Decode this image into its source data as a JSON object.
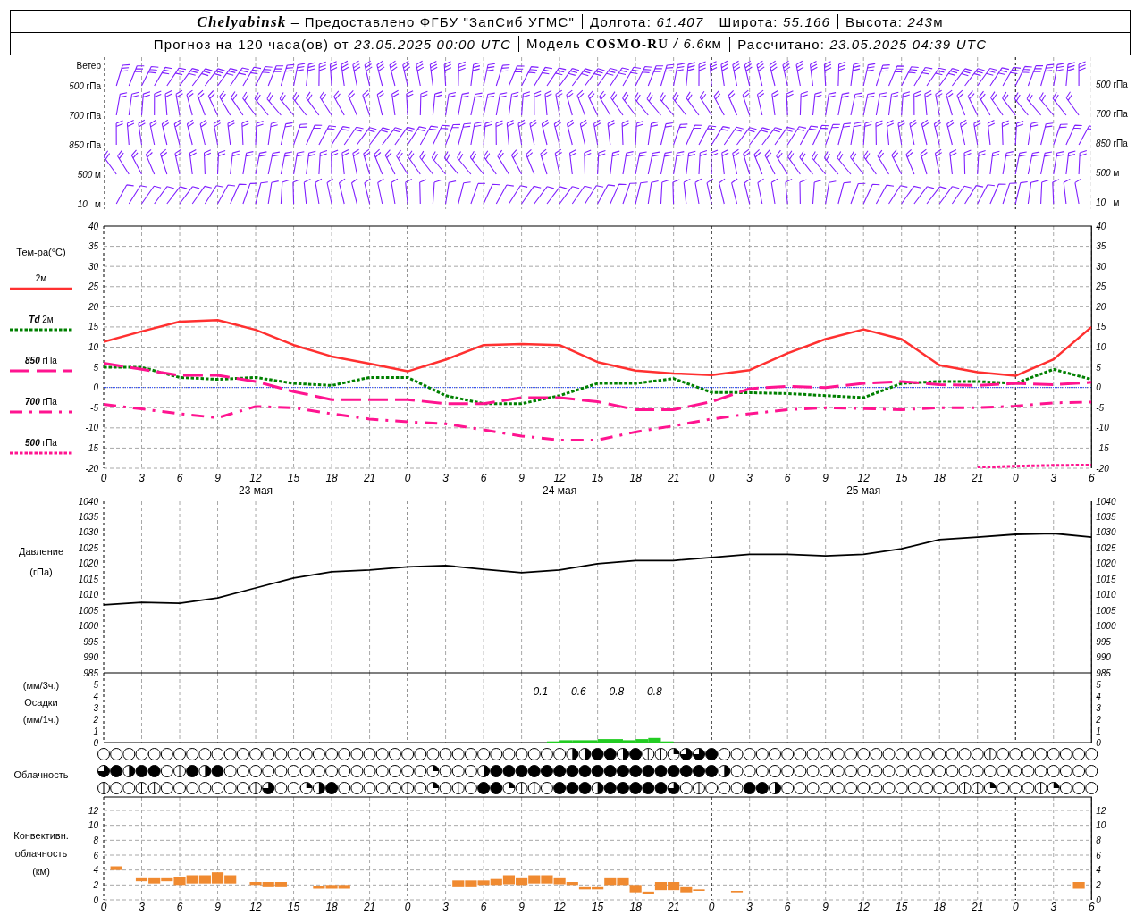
{
  "header": {
    "lines": [
      [
        [
          "**Chelyabinsk** – Предоставлено ФГБУ \"ЗапСиб УГМС\""
        ],
        [
          "Долгота: *61.407*"
        ],
        [
          "Широта: *55.166*"
        ],
        [
          "Высота: *243*",
          "м"
        ]
      ],
      [
        [
          "Прогноз на 120 часа(ов) от *23.05.2025 00:00 UTC*"
        ],
        [
          "Модель **COSMO-RU** */ 6.6*",
          "км"
        ],
        [
          "Рассчитано: *23.05.2025 04:39 UTC*"
        ]
      ]
    ]
  },
  "wind": {
    "title": "Ветер",
    "left_labels": [
      "*500* гПа",
      "*700* гПа",
      "*850* гПа",
      "*500* м",
      "*10*   м"
    ],
    "right_labels": [
      "*500* гПа",
      "*700* гПа",
      "*850* гПа",
      "*500* м",
      "*10*   м"
    ]
  },
  "temperature": {
    "title": "Тем-ра(°C)",
    "date_labels": [
      "23 мая",
      "24 мая",
      "25 мая"
    ],
    "chart_data": {
      "type": "line",
      "grid": true,
      "xlim": [
        "2025-05-23T00:00",
        "2025-05-26T06:00"
      ],
      "x": [
        "2025-05-23T00:00",
        "2025-05-23T03:00",
        "2025-05-23T06:00",
        "2025-05-23T09:00",
        "2025-05-23T12:00",
        "2025-05-23T15:00",
        "2025-05-23T18:00",
        "2025-05-23T21:00",
        "2025-05-24T00:00",
        "2025-05-24T03:00",
        "2025-05-24T06:00",
        "2025-05-24T09:00",
        "2025-05-24T12:00",
        "2025-05-24T15:00",
        "2025-05-24T18:00",
        "2025-05-24T21:00",
        "2025-05-25T00:00",
        "2025-05-25T03:00",
        "2025-05-25T06:00",
        "2025-05-25T09:00",
        "2025-05-25T12:00",
        "2025-05-25T15:00",
        "2025-05-25T18:00",
        "2025-05-25T21:00",
        "2025-05-26T00:00",
        "2025-05-26T03:00",
        "2025-05-26T06:00"
      ],
      "ylim": [
        -20,
        40
      ],
      "y2lim": [
        -20,
        40
      ],
      "yticks": [
        -20,
        -15,
        -10,
        -5,
        0,
        5,
        10,
        15,
        20,
        25,
        30,
        35,
        40
      ],
      "y2ticks": [
        -20,
        -15,
        -10,
        -5,
        0,
        5,
        10,
        15,
        20,
        25,
        30,
        35,
        40
      ],
      "xticks": [
        {
          "value": "2025-05-23T00:00",
          "label": "0"
        },
        {
          "value": "2025-05-23T03:00",
          "label": "3"
        },
        {
          "value": "2025-05-23T06:00",
          "label": "6"
        },
        {
          "value": "2025-05-23T09:00",
          "label": "9"
        },
        {
          "value": "2025-05-23T12:00",
          "label": "12"
        },
        {
          "value": "2025-05-23T15:00",
          "label": "15"
        },
        {
          "value": "2025-05-23T18:00",
          "label": "18"
        },
        {
          "value": "2025-05-23T21:00",
          "label": "21"
        },
        {
          "value": "2025-05-24T00:00",
          "label": "0"
        },
        {
          "value": "2025-05-24T03:00",
          "label": "3"
        },
        {
          "value": "2025-05-24T06:00",
          "label": "6"
        },
        {
          "value": "2025-05-24T09:00",
          "label": "9"
        },
        {
          "value": "2025-05-24T12:00",
          "label": "12"
        },
        {
          "value": "2025-05-24T15:00",
          "label": "15"
        },
        {
          "value": "2025-05-24T18:00",
          "label": "18"
        },
        {
          "value": "2025-05-24T21:00",
          "label": "21"
        },
        {
          "value": "2025-05-25T00:00",
          "label": "0"
        },
        {
          "value": "2025-05-25T03:00",
          "label": "3"
        },
        {
          "value": "2025-05-25T06:00",
          "label": "6"
        },
        {
          "value": "2025-05-25T09:00",
          "label": "9"
        },
        {
          "value": "2025-05-25T12:00",
          "label": "12"
        },
        {
          "value": "2025-05-25T15:00",
          "label": "15"
        },
        {
          "value": "2025-05-25T18:00",
          "label": "18"
        },
        {
          "value": "2025-05-25T21:00",
          "label": "21"
        },
        {
          "value": "2025-05-26T00:00",
          "label": "0"
        },
        {
          "value": "2025-05-26T03:00",
          "label": "3"
        },
        {
          "value": "2025-05-26T06:00",
          "label": "6"
        }
      ],
      "ref_lines": [
        {
          "axis": "y",
          "value": 0,
          "color": "#2040ff"
        }
      ],
      "series": [
        {
          "name": "2м",
          "line_style": "solid",
          "color": "#ff3030",
          "values": [
            11.3,
            13.9,
            16.3,
            16.7,
            14.3,
            10.5,
            7.7,
            5.9,
            4,
            6.9,
            10.5,
            10.8,
            10.5,
            6.3,
            4.2,
            3.5,
            3.1,
            4.3,
            8.5,
            12,
            14.4,
            12,
            5.5,
            3.8,
            2.9,
            7,
            15
          ]
        },
        {
          "name": "*Td* 2м",
          "line_style": "dotted",
          "color": "#008000",
          "values": [
            5,
            5,
            2.5,
            2,
            2.5,
            1,
            0.5,
            2.5,
            2.5,
            -2,
            -4,
            -4,
            -2,
            1,
            1,
            2.2,
            -1.2,
            -1.3,
            -1.5,
            -2,
            -2.5,
            1,
            1.5,
            1.5,
            1,
            4.5,
            2
          ]
        },
        {
          "name": "*850* гПа",
          "line_style": "dashed",
          "color": "#ff1490",
          "values": [
            6,
            4.5,
            3,
            3,
            1.5,
            -1,
            -3,
            -3,
            -3,
            -4,
            -4,
            -2.5,
            -2.5,
            -3.5,
            -5.5,
            -5.5,
            -3.5,
            -0.3,
            0.3,
            0,
            1,
            1.5,
            0.7,
            0.5,
            1,
            0.7,
            1.3
          ]
        },
        {
          "name": "*700* гПа",
          "line_style": "dashdot",
          "color": "#ff1490",
          "values": [
            -4.2,
            -5.3,
            -6.5,
            -7.5,
            -4.7,
            -5,
            -6.5,
            -7.8,
            -8.5,
            -9,
            -10.5,
            -12,
            -13,
            -13,
            -11,
            -9.5,
            -7.8,
            -6.5,
            -5.5,
            -5,
            -5.2,
            -5.5,
            -5,
            -5,
            -4.6,
            -3.8,
            -3.6
          ]
        },
        {
          "name": "*500* гПа",
          "line_style": "dotted",
          "color": "#ff1490",
          "values": [
            null,
            null,
            null,
            null,
            null,
            null,
            null,
            null,
            null,
            null,
            null,
            null,
            null,
            null,
            null,
            null,
            null,
            null,
            null,
            null,
            null,
            null,
            null,
            -19.8,
            -19.5,
            -19.3,
            -19.2
          ]
        }
      ]
    }
  },
  "pressure": {
    "labels": [
      "Давление",
      "(гПа)"
    ],
    "chart_data": {
      "type": "line",
      "grid": true,
      "xlim": [
        "2025-05-23T00:00",
        "2025-05-26T06:00"
      ],
      "x": [
        "2025-05-23T00:00",
        "2025-05-23T03:00",
        "2025-05-23T06:00",
        "2025-05-23T09:00",
        "2025-05-23T12:00",
        "2025-05-23T15:00",
        "2025-05-23T18:00",
        "2025-05-23T21:00",
        "2025-05-24T00:00",
        "2025-05-24T03:00",
        "2025-05-24T06:00",
        "2025-05-24T09:00",
        "2025-05-24T12:00",
        "2025-05-24T15:00",
        "2025-05-24T18:00",
        "2025-05-24T21:00",
        "2025-05-25T00:00",
        "2025-05-25T03:00",
        "2025-05-25T06:00",
        "2025-05-25T09:00",
        "2025-05-25T12:00",
        "2025-05-25T15:00",
        "2025-05-25T18:00",
        "2025-05-25T21:00",
        "2025-05-26T00:00",
        "2025-05-26T03:00",
        "2025-05-26T06:00"
      ],
      "ylim": [
        985,
        1040
      ],
      "y2lim": [
        985,
        1040
      ],
      "yticks": [
        985,
        990,
        995,
        1000,
        1005,
        1010,
        1015,
        1020,
        1025,
        1030,
        1035,
        1040
      ],
      "y2ticks": [
        985,
        990,
        995,
        1000,
        1005,
        1010,
        1015,
        1020,
        1025,
        1030,
        1035,
        1040
      ],
      "series": [
        {
          "color": "#000000",
          "values": [
            1006.8,
            1007.6,
            1007.3,
            1009,
            1012.2,
            1015.4,
            1017.4,
            1018,
            1019,
            1019.4,
            1018.2,
            1017.1,
            1018,
            1020,
            1021,
            1021,
            1022,
            1023,
            1023,
            1022.5,
            1023,
            1024.8,
            1027.7,
            1028.5,
            1029.4,
            1029.7,
            1028.5
          ]
        }
      ]
    }
  },
  "precipitation": {
    "labels": [
      "(мм/3ч.)",
      "Осадки",
      "(мм/1ч.)"
    ],
    "chart_data": {
      "type": "bar",
      "grid": true,
      "xlim": [
        "2025-05-23T00:00",
        "2025-05-26T06:00"
      ],
      "x": [
        "2025-05-24T11:30",
        "2025-05-24T12:30",
        "2025-05-24T13:30",
        "2025-05-24T14:30",
        "2025-05-24T15:30",
        "2025-05-24T16:30",
        "2025-05-24T17:30",
        "2025-05-24T18:30",
        "2025-05-24T19:30",
        "2025-05-24T20:30"
      ],
      "ylim": [
        0,
        6
      ],
      "y2lim": [
        0,
        6
      ],
      "yticks": [
        0,
        1,
        2,
        3,
        4,
        5
      ],
      "y2ticks": [
        0,
        1,
        2,
        3,
        4,
        5
      ],
      "series": [
        {
          "color": "#22cc22",
          "values": [
            0.1,
            0.2,
            0.2,
            0.2,
            0.3,
            0.3,
            0.2,
            0.3,
            0.4,
            0.1
          ]
        }
      ],
      "annotations": [
        "0.1",
        "0.6",
        "0.8",
        "0.8"
      ]
    }
  },
  "cloud": {
    "label": "Облачность",
    "rows": [
      {
        "cells": [
          {
            "kind": "clear"
          },
          {
            "kind": "clear"
          },
          {
            "kind": "clear"
          },
          {
            "kind": "clear"
          },
          {
            "kind": "clear"
          },
          {
            "kind": "clear"
          },
          {
            "kind": "clear"
          },
          {
            "kind": "clear"
          },
          {
            "kind": "clear"
          },
          {
            "kind": "clear"
          },
          {
            "kind": "clear"
          },
          {
            "kind": "clear"
          },
          {
            "kind": "clear"
          },
          {
            "kind": "clear"
          },
          {
            "kind": "clear"
          },
          {
            "kind": "clear"
          },
          {
            "kind": "clear"
          },
          {
            "kind": "clear"
          },
          {
            "kind": "clear"
          },
          {
            "kind": "clear"
          },
          {
            "kind": "clear"
          },
          {
            "kind": "clear"
          },
          {
            "kind": "clear"
          },
          {
            "kind": "clear"
          },
          {
            "kind": "clear"
          },
          {
            "kind": "clear"
          },
          {
            "kind": "clear"
          },
          {
            "kind": "clear"
          },
          {
            "kind": "clear"
          },
          {
            "kind": "clear"
          },
          {
            "kind": "clear"
          },
          {
            "kind": "clear"
          },
          {
            "kind": "clear"
          },
          {
            "kind": "clear"
          },
          {
            "kind": "clear"
          },
          {
            "kind": "clear"
          },
          {
            "kind": "clear"
          },
          {
            "kind": "half"
          },
          {
            "kind": "half"
          },
          {
            "kind": "overcast"
          },
          {
            "kind": "overcast"
          },
          {
            "kind": "half"
          },
          {
            "kind": "overcast"
          },
          {
            "kind": "line"
          },
          {
            "kind": "line"
          },
          {
            "kind": "quarter"
          },
          {
            "kind": "three-quarter"
          },
          {
            "kind": "three-quarter"
          },
          {
            "kind": "overcast"
          },
          {
            "kind": "clear"
          },
          {
            "kind": "clear"
          },
          {
            "kind": "clear"
          },
          {
            "kind": "clear"
          },
          {
            "kind": "clear"
          },
          {
            "kind": "clear"
          },
          {
            "kind": "clear"
          },
          {
            "kind": "clear"
          },
          {
            "kind": "clear"
          },
          {
            "kind": "clear"
          },
          {
            "kind": "clear"
          },
          {
            "kind": "clear"
          },
          {
            "kind": "clear"
          },
          {
            "kind": "clear"
          },
          {
            "kind": "clear"
          },
          {
            "kind": "clear"
          },
          {
            "kind": "clear"
          },
          {
            "kind": "clear"
          },
          {
            "kind": "clear"
          },
          {
            "kind": "clear"
          },
          {
            "kind": "clear"
          },
          {
            "kind": "line"
          },
          {
            "kind": "clear"
          },
          {
            "kind": "clear"
          },
          {
            "kind": "clear"
          },
          {
            "kind": "clear"
          },
          {
            "kind": "clear"
          },
          {
            "kind": "clear"
          },
          {
            "kind": "clear"
          },
          {
            "kind": "clear"
          }
        ]
      },
      {
        "cells": [
          {
            "kind": "three-quarter"
          },
          {
            "kind": "overcast"
          },
          {
            "kind": "half"
          },
          {
            "kind": "overcast"
          },
          {
            "kind": "overcast"
          },
          {
            "kind": "clear"
          },
          {
            "kind": "line"
          },
          {
            "kind": "overcast"
          },
          {
            "kind": "half"
          },
          {
            "kind": "overcast"
          },
          {
            "kind": "clear"
          },
          {
            "kind": "clear"
          },
          {
            "kind": "clear"
          },
          {
            "kind": "clear"
          },
          {
            "kind": "clear"
          },
          {
            "kind": "clear"
          },
          {
            "kind": "clear"
          },
          {
            "kind": "clear"
          },
          {
            "kind": "clear"
          },
          {
            "kind": "clear"
          },
          {
            "kind": "clear"
          },
          {
            "kind": "clear"
          },
          {
            "kind": "clear"
          },
          {
            "kind": "clear"
          },
          {
            "kind": "clear"
          },
          {
            "kind": "clear"
          },
          {
            "kind": "quarter"
          },
          {
            "kind": "clear"
          },
          {
            "kind": "clear"
          },
          {
            "kind": "clear"
          },
          {
            "kind": "half"
          },
          {
            "kind": "overcast"
          },
          {
            "kind": "overcast"
          },
          {
            "kind": "overcast"
          },
          {
            "kind": "overcast"
          },
          {
            "kind": "overcast"
          },
          {
            "kind": "overcast"
          },
          {
            "kind": "overcast"
          },
          {
            "kind": "overcast"
          },
          {
            "kind": "overcast"
          },
          {
            "kind": "overcast"
          },
          {
            "kind": "overcast"
          },
          {
            "kind": "overcast"
          },
          {
            "kind": "overcast"
          },
          {
            "kind": "overcast"
          },
          {
            "kind": "overcast"
          },
          {
            "kind": "overcast"
          },
          {
            "kind": "overcast"
          },
          {
            "kind": "overcast"
          },
          {
            "kind": "half"
          },
          {
            "kind": "clear"
          },
          {
            "kind": "clear"
          },
          {
            "kind": "clear"
          },
          {
            "kind": "clear"
          },
          {
            "kind": "clear"
          },
          {
            "kind": "clear"
          },
          {
            "kind": "clear"
          },
          {
            "kind": "clear"
          },
          {
            "kind": "clear"
          },
          {
            "kind": "clear"
          },
          {
            "kind": "clear"
          },
          {
            "kind": "clear"
          },
          {
            "kind": "clear"
          },
          {
            "kind": "clear"
          },
          {
            "kind": "clear"
          },
          {
            "kind": "clear"
          },
          {
            "kind": "clear"
          },
          {
            "kind": "clear"
          },
          {
            "kind": "clear"
          },
          {
            "kind": "clear"
          },
          {
            "kind": "clear"
          },
          {
            "kind": "clear"
          },
          {
            "kind": "clear"
          },
          {
            "kind": "clear"
          },
          {
            "kind": "clear"
          },
          {
            "kind": "clear"
          },
          {
            "kind": "clear"
          },
          {
            "kind": "clear"
          },
          {
            "kind": "clear"
          }
        ]
      },
      {
        "cells": [
          {
            "kind": "line"
          },
          {
            "kind": "clear"
          },
          {
            "kind": "clear"
          },
          {
            "kind": "line"
          },
          {
            "kind": "line"
          },
          {
            "kind": "clear"
          },
          {
            "kind": "clear"
          },
          {
            "kind": "clear"
          },
          {
            "kind": "clear"
          },
          {
            "kind": "clear"
          },
          {
            "kind": "clear"
          },
          {
            "kind": "clear"
          },
          {
            "kind": "line"
          },
          {
            "kind": "three-quarter"
          },
          {
            "kind": "clear"
          },
          {
            "kind": "clear"
          },
          {
            "kind": "quarter"
          },
          {
            "kind": "half"
          },
          {
            "kind": "overcast"
          },
          {
            "kind": "clear"
          },
          {
            "kind": "clear"
          },
          {
            "kind": "clear"
          },
          {
            "kind": "clear"
          },
          {
            "kind": "clear"
          },
          {
            "kind": "line"
          },
          {
            "kind": "clear"
          },
          {
            "kind": "quarter"
          },
          {
            "kind": "clear"
          },
          {
            "kind": "line"
          },
          {
            "kind": "clear"
          },
          {
            "kind": "overcast"
          },
          {
            "kind": "overcast"
          },
          {
            "kind": "quarter"
          },
          {
            "kind": "line"
          },
          {
            "kind": "line"
          },
          {
            "kind": "clear"
          },
          {
            "kind": "overcast"
          },
          {
            "kind": "overcast"
          },
          {
            "kind": "overcast"
          },
          {
            "kind": "half"
          },
          {
            "kind": "overcast"
          },
          {
            "kind": "overcast"
          },
          {
            "kind": "overcast"
          },
          {
            "kind": "overcast"
          },
          {
            "kind": "overcast"
          },
          {
            "kind": "three-quarter"
          },
          {
            "kind": "clear"
          },
          {
            "kind": "line"
          },
          {
            "kind": "clear"
          },
          {
            "kind": "clear"
          },
          {
            "kind": "clear"
          },
          {
            "kind": "overcast"
          },
          {
            "kind": "overcast"
          },
          {
            "kind": "half"
          },
          {
            "kind": "clear"
          },
          {
            "kind": "clear"
          },
          {
            "kind": "clear"
          },
          {
            "kind": "clear"
          },
          {
            "kind": "clear"
          },
          {
            "kind": "clear"
          },
          {
            "kind": "clear"
          },
          {
            "kind": "clear"
          },
          {
            "kind": "clear"
          },
          {
            "kind": "clear"
          },
          {
            "kind": "clear"
          },
          {
            "kind": "clear"
          },
          {
            "kind": "clear"
          },
          {
            "kind": "clear"
          },
          {
            "kind": "line"
          },
          {
            "kind": "line"
          },
          {
            "kind": "quarter"
          },
          {
            "kind": "clear"
          },
          {
            "kind": "clear"
          },
          {
            "kind": "clear"
          },
          {
            "kind": "line"
          },
          {
            "kind": "quarter"
          },
          {
            "kind": "clear"
          },
          {
            "kind": "clear"
          },
          {
            "kind": "clear"
          }
        ]
      }
    ]
  },
  "convective": {
    "labels": [
      "Конвективн.",
      "облачность",
      "(км)"
    ],
    "chart_data": {
      "type": "candlestick",
      "grid": true,
      "xlim": [
        "2025-05-23T00:00",
        "2025-05-26T06:00"
      ],
      "ylim": [
        0,
        12
      ],
      "y2lim": [
        0,
        12
      ],
      "yticks": [
        0,
        2,
        4,
        6,
        8,
        10,
        12
      ],
      "y2ticks": [
        0,
        2,
        4,
        6,
        8,
        10,
        12
      ],
      "xticks": [
        {
          "value": "2025-05-23T00:00",
          "label": "0"
        },
        {
          "value": "2025-05-23T03:00",
          "label": "3"
        },
        {
          "value": "2025-05-23T06:00",
          "label": "6"
        },
        {
          "value": "2025-05-23T09:00",
          "label": "9"
        },
        {
          "value": "2025-05-23T12:00",
          "label": "12"
        },
        {
          "value": "2025-05-23T15:00",
          "label": "15"
        },
        {
          "value": "2025-05-23T18:00",
          "label": "18"
        },
        {
          "value": "2025-05-23T21:00",
          "label": "21"
        },
        {
          "value": "2025-05-24T00:00",
          "label": "0"
        },
        {
          "value": "2025-05-24T03:00",
          "label": "3"
        },
        {
          "value": "2025-05-24T06:00",
          "label": "6"
        },
        {
          "value": "2025-05-24T09:00",
          "label": "9"
        },
        {
          "value": "2025-05-24T12:00",
          "label": "12"
        },
        {
          "value": "2025-05-24T15:00",
          "label": "15"
        },
        {
          "value": "2025-05-24T18:00",
          "label": "18"
        },
        {
          "value": "2025-05-24T21:00",
          "label": "21"
        },
        {
          "value": "2025-05-25T00:00",
          "label": "0"
        },
        {
          "value": "2025-05-25T03:00",
          "label": "3"
        },
        {
          "value": "2025-05-25T06:00",
          "label": "6"
        },
        {
          "value": "2025-05-25T09:00",
          "label": "9"
        },
        {
          "value": "2025-05-25T12:00",
          "label": "12"
        },
        {
          "value": "2025-05-25T15:00",
          "label": "15"
        },
        {
          "value": "2025-05-25T18:00",
          "label": "18"
        },
        {
          "value": "2025-05-25T21:00",
          "label": "21"
        },
        {
          "value": "2025-05-26T00:00",
          "label": "0"
        },
        {
          "value": "2025-05-26T03:00",
          "label": "3"
        },
        {
          "value": "2025-05-26T06:00",
          "label": "6"
        }
      ],
      "x": [
        "2025-05-23T01:00",
        "2025-05-23T03:00",
        "2025-05-23T04:00",
        "2025-05-23T05:00",
        "2025-05-23T06:00",
        "2025-05-23T07:00",
        "2025-05-23T08:00",
        "2025-05-23T09:00",
        "2025-05-23T10:00",
        "2025-05-23T12:00",
        "2025-05-23T13:00",
        "2025-05-23T14:00",
        "2025-05-23T17:00",
        "2025-05-23T18:00",
        "2025-05-23T19:00",
        "2025-05-24T04:00",
        "2025-05-24T05:00",
        "2025-05-24T06:00",
        "2025-05-24T07:00",
        "2025-05-24T08:00",
        "2025-05-24T09:00",
        "2025-05-24T10:00",
        "2025-05-24T11:00",
        "2025-05-24T12:00",
        "2025-05-24T13:00",
        "2025-05-24T14:00",
        "2025-05-24T15:00",
        "2025-05-24T16:00",
        "2025-05-24T17:00",
        "2025-05-24T18:00",
        "2025-05-24T19:00",
        "2025-05-24T20:00",
        "2025-05-24T21:00",
        "2025-05-24T22:00",
        "2025-05-24T23:00",
        "2025-05-25T02:00",
        "2025-05-26T05:00"
      ],
      "ohlc": [
        [
          4.0,
          4.5,
          4.0,
          4.5
        ],
        [
          2.5,
          2.9,
          2.5,
          2.9
        ],
        [
          2.2,
          2.9,
          2.2,
          2.9
        ],
        [
          2.5,
          2.9,
          2.5,
          2.9
        ],
        [
          2.0,
          3.0,
          2.0,
          3.0
        ],
        [
          2.2,
          3.3,
          2.2,
          3.3
        ],
        [
          2.2,
          3.3,
          2.2,
          3.3
        ],
        [
          2.2,
          3.7,
          2.2,
          3.7
        ],
        [
          2.2,
          3.3,
          2.2,
          3.3
        ],
        [
          2.0,
          2.4,
          2.0,
          2.4
        ],
        [
          1.7,
          2.4,
          1.7,
          2.4
        ],
        [
          1.7,
          2.4,
          1.7,
          2.4
        ],
        [
          1.5,
          1.8,
          1.5,
          1.8
        ],
        [
          1.5,
          2.0,
          1.5,
          2.0
        ],
        [
          1.5,
          2.0,
          1.5,
          2.0
        ],
        [
          1.7,
          2.6,
          1.7,
          2.6
        ],
        [
          1.7,
          2.6,
          1.7,
          2.6
        ],
        [
          2.0,
          2.6,
          2.0,
          2.6
        ],
        [
          2.0,
          2.8,
          2.0,
          2.8
        ],
        [
          2.1,
          3.3,
          2.1,
          3.3
        ],
        [
          2.0,
          2.9,
          2.0,
          2.9
        ],
        [
          2.2,
          3.3,
          2.2,
          3.3
        ],
        [
          2.2,
          3.3,
          2.2,
          3.3
        ],
        [
          2.1,
          2.9,
          2.1,
          2.9
        ],
        [
          2.0,
          2.4,
          2.0,
          2.4
        ],
        [
          1.4,
          1.7,
          1.4,
          1.7
        ],
        [
          1.4,
          1.7,
          1.4,
          1.7
        ],
        [
          2.0,
          2.9,
          2.0,
          2.9
        ],
        [
          2.0,
          2.9,
          2.0,
          2.9
        ],
        [
          1.0,
          2.0,
          1.0,
          2.0
        ],
        [
          0.8,
          1.1,
          0.8,
          1.1
        ],
        [
          1.3,
          2.4,
          1.3,
          2.4
        ],
        [
          1.3,
          2.4,
          1.3,
          2.4
        ],
        [
          1.0,
          1.7,
          1.0,
          1.7
        ],
        [
          1.2,
          1.4,
          1.2,
          1.4
        ],
        [
          1.0,
          1.2,
          1.0,
          1.2
        ],
        [
          1.5,
          2.4,
          1.5,
          2.4
        ]
      ]
    }
  }
}
